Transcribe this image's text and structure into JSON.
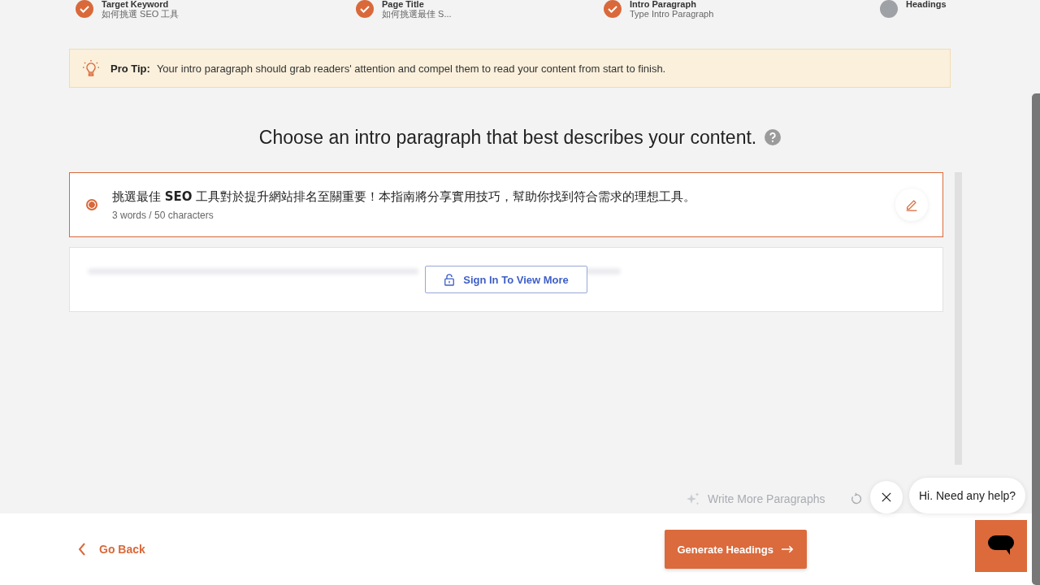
{
  "steps": [
    {
      "title": "Target Keyword",
      "subtitle": "如何挑選 SEO 工具",
      "done": true
    },
    {
      "title": "Page Title",
      "subtitle": "如何挑選最佳 S...",
      "done": true
    },
    {
      "title": "Intro Paragraph",
      "subtitle": "Type Intro Paragraph",
      "done": true
    },
    {
      "title": "Headings",
      "done": false
    }
  ],
  "tip": {
    "label": "Pro Tip:",
    "text": "Your intro paragraph should grab readers' attention and compel them to read your content from start to finish."
  },
  "heading": "Choose an intro paragraph that best describes your content.",
  "options": [
    {
      "kind": "paragraph",
      "text": "挑選最佳 **SEO** 工具對於提升網站排名至關重要！本指南將分享實用技巧，幫助你找到符合需求的理想工具。",
      "meta": "3 words / 50 characters",
      "selected": true
    },
    {
      "kind": "locked",
      "button": "Sign In To View More"
    }
  ],
  "actions": {
    "write_more": "Write More Paragraphs"
  },
  "footer": {
    "back": "Go Back",
    "next": "Generate Headings"
  },
  "chat": {
    "message": "Hi. Need any help?"
  }
}
